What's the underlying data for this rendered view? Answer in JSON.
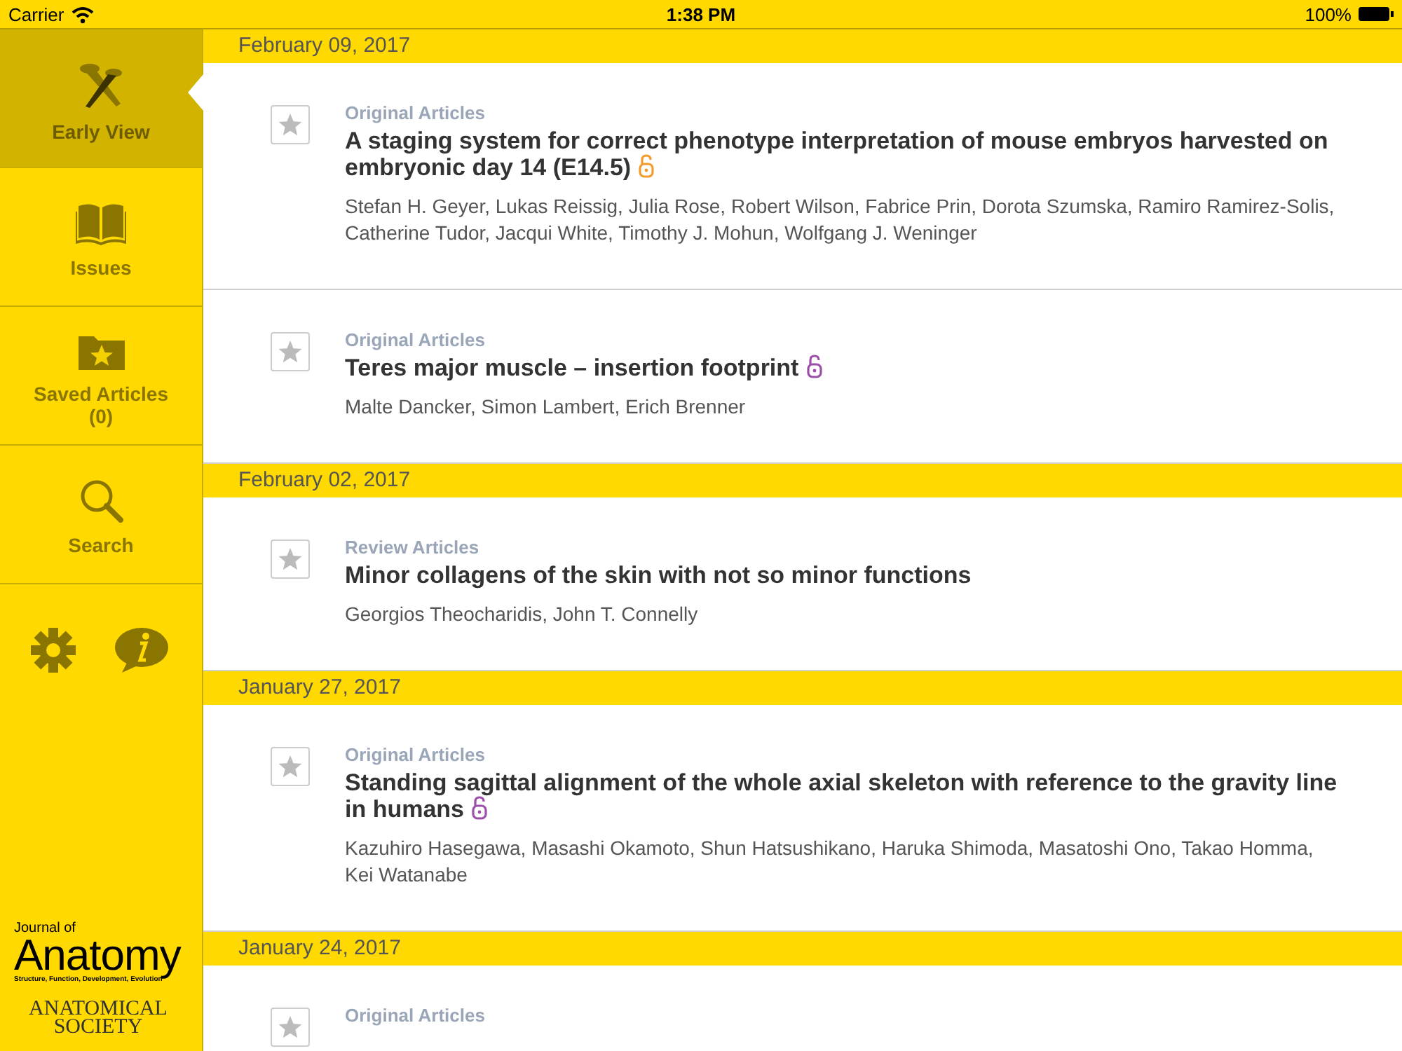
{
  "status_bar": {
    "carrier": "Carrier",
    "time": "1:38 PM",
    "battery": "100%"
  },
  "sidebar": {
    "items": [
      {
        "kind": "early",
        "label": "Early View",
        "selected": true
      },
      {
        "kind": "issues",
        "label": "Issues",
        "selected": false
      },
      {
        "kind": "saved",
        "label": "Saved Articles",
        "count": "(0)",
        "selected": false
      },
      {
        "kind": "search",
        "label": "Search",
        "selected": false
      }
    ],
    "logo": {
      "prefix": "Journal of",
      "name": "Anatomy",
      "subtitle": "Structure, Function, Development, Evolution",
      "society": "ANATOMICAL SOCIETY"
    }
  },
  "sections": [
    {
      "date": "February 09, 2017",
      "articles": [
        {
          "category": "Original Articles",
          "title": "A staging system for correct phenotype interpretation of mouse embryos harvested on embryonic day 14 (E14.5)",
          "open_access": true,
          "color": "#f39a2c",
          "authors": "Stefan H. Geyer, Lukas Reissig, Julia Rose, Robert Wilson, Fabrice Prin, Dorota Szumska, Ramiro Ramirez-Solis, Catherine Tudor, Jacqui White, Timothy J. Mohun, Wolfgang J. Weninger",
          "saved": false
        },
        {
          "category": "Original Articles",
          "title": "Teres major muscle – insertion footprint",
          "open_access": true,
          "color": "#9b4fa8",
          "authors": "Malte Dancker, Simon Lambert, Erich Brenner",
          "saved": false
        }
      ]
    },
    {
      "date": "February 02, 2017",
      "articles": [
        {
          "category": "Review Articles",
          "title": "Minor collagens of the skin with not so minor functions",
          "open_access": false,
          "authors": "Georgios Theocharidis, John T. Connelly",
          "saved": false
        }
      ]
    },
    {
      "date": "January 27, 2017",
      "articles": [
        {
          "category": "Original Articles",
          "title": "Standing sagittal alignment of the whole axial skeleton with reference to the gravity line in humans",
          "open_access": true,
          "color": "#9b4fa8",
          "authors": "Kazuhiro Hasegawa, Masashi Okamoto, Shun Hatsushikano, Haruka Shimoda, Masatoshi Ono, Takao Homma, Kei Watanabe",
          "saved": false
        }
      ]
    },
    {
      "date": "January 24, 2017",
      "articles": [
        {
          "category": "Original Articles",
          "saved": false
        }
      ]
    }
  ]
}
